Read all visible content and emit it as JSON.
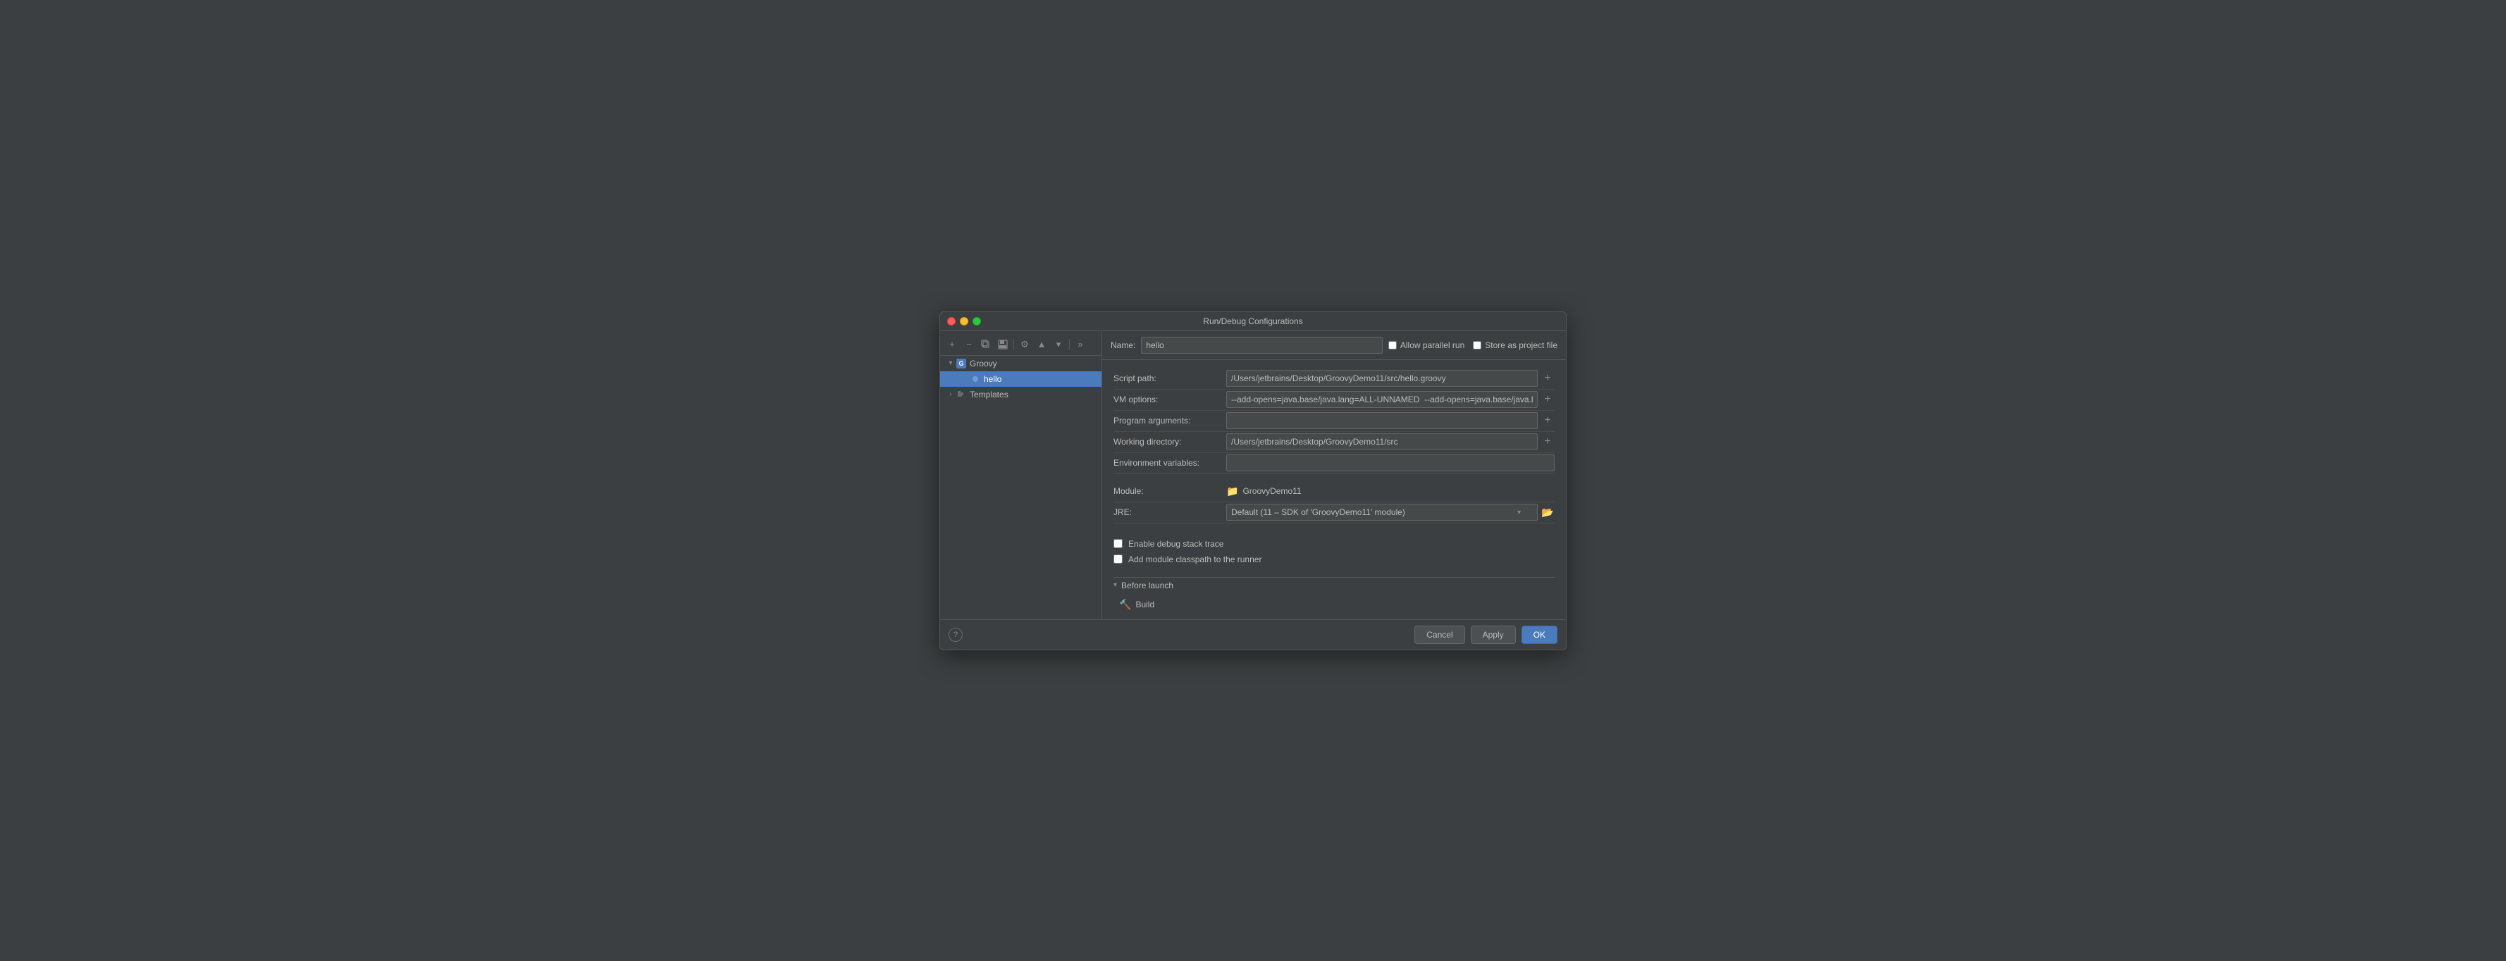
{
  "window": {
    "title": "Run/Debug Configurations"
  },
  "toolbar": {
    "add_tooltip": "Add",
    "remove_tooltip": "Remove",
    "copy_tooltip": "Copy",
    "save_tooltip": "Save",
    "wrench_tooltip": "Wrench",
    "up_tooltip": "Move Up",
    "down_tooltip": "Move Down",
    "expand_tooltip": "Expand"
  },
  "sidebar": {
    "groovy_label": "Groovy",
    "hello_label": "hello",
    "templates_label": "Templates"
  },
  "header": {
    "name_label": "Name:",
    "name_value": "hello",
    "allow_parallel_label": "Allow parallel run",
    "store_as_project_label": "Store as project file"
  },
  "form": {
    "script_path_label": "Script path:",
    "script_path_value": "/Users/jetbrains/Desktop/GroovyDemo11/src/hello.groovy",
    "vm_options_label": "VM options:",
    "vm_options_value": "--add-opens=java.base/java.lang=ALL-UNNAMED  --add-opens=java.base/java.lang.invoke=ALL-UNNAMED",
    "program_args_label": "Program arguments:",
    "program_args_value": "",
    "working_dir_label": "Working directory:",
    "working_dir_value": "/Users/jetbrains/Desktop/GroovyDemo11/src",
    "env_vars_label": "Environment variables:",
    "env_vars_value": "",
    "module_label": "Module:",
    "module_value": "GroovyDemo11",
    "jre_label": "JRE:",
    "jre_value": "Default",
    "jre_secondary": "(11 – SDK of 'GroovyDemo11' module)"
  },
  "checkboxes": {
    "debug_stack_label": "Enable debug stack trace",
    "module_classpath_label": "Add module classpath to the runner"
  },
  "before_launch": {
    "section_label": "Before launch",
    "build_label": "Build"
  },
  "buttons": {
    "cancel_label": "Cancel",
    "apply_label": "Apply",
    "ok_label": "OK"
  },
  "icons": {
    "groovy": "G",
    "wrench": "🔧",
    "folder": "📁",
    "build": "🔨"
  }
}
